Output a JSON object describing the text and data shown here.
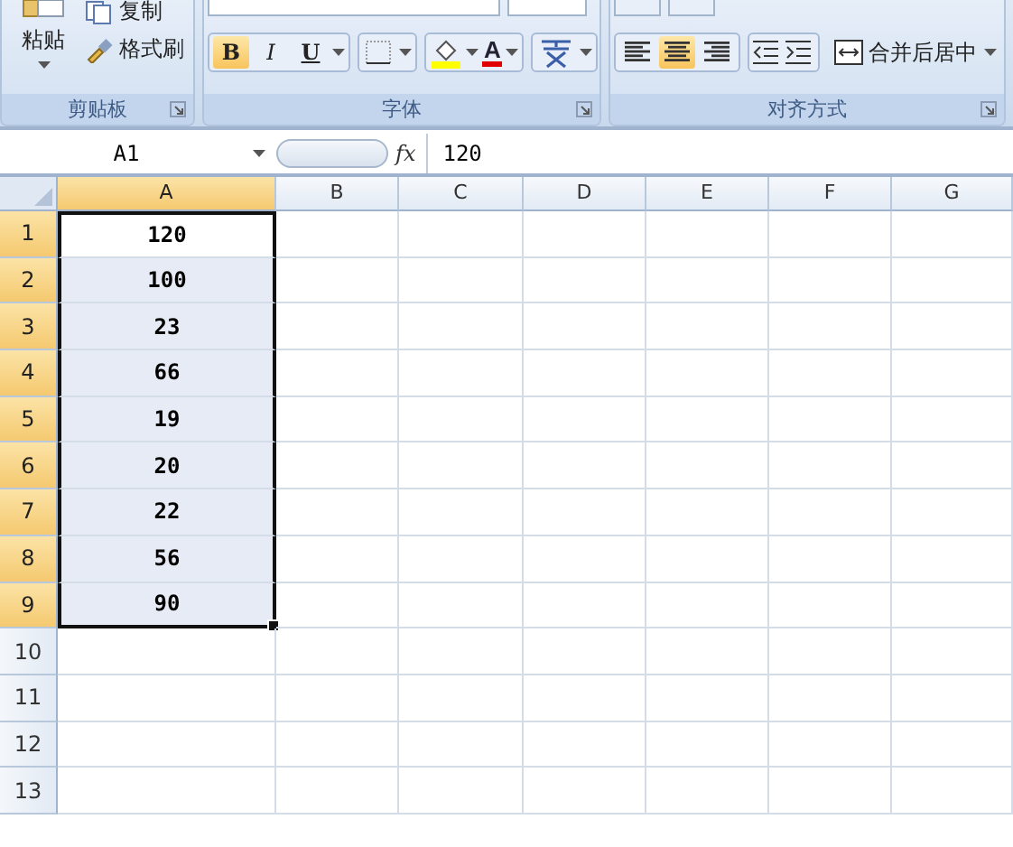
{
  "ribbon": {
    "groups": [
      {
        "kind": "clipboard",
        "label": "剪贴板",
        "paste_label": "粘贴",
        "items": [
          {
            "kind": "copy",
            "label": "复制"
          },
          {
            "kind": "painter",
            "label": "格式刷"
          }
        ]
      },
      {
        "kind": "font",
        "label": "字体",
        "style_buttons": [
          {
            "label": "B",
            "selected": true
          },
          {
            "label": "I",
            "selected": false
          },
          {
            "label": "U",
            "selected": false
          }
        ],
        "font_color_label": "A"
      },
      {
        "kind": "alignment",
        "label": "对齐方式",
        "align_buttons": [
          {
            "selected": false
          },
          {
            "selected": true
          },
          {
            "selected": false
          }
        ],
        "merge_label": "合并后居中"
      }
    ]
  },
  "formula_bar": {
    "name_box": "A1",
    "function_label": "fx",
    "formula": "120"
  },
  "sheet": {
    "columns": [
      {
        "label": "A",
        "selected": true
      },
      {
        "label": "B",
        "selected": false
      },
      {
        "label": "C",
        "selected": false
      },
      {
        "label": "D",
        "selected": false
      },
      {
        "label": "E",
        "selected": false
      },
      {
        "label": "F",
        "selected": false
      },
      {
        "label": "G",
        "selected": false
      }
    ],
    "rows": [
      {
        "label": "1",
        "selected": true,
        "value": "120"
      },
      {
        "label": "2",
        "selected": true,
        "value": "100"
      },
      {
        "label": "3",
        "selected": true,
        "value": "23"
      },
      {
        "label": "4",
        "selected": true,
        "value": "66"
      },
      {
        "label": "5",
        "selected": true,
        "value": "19"
      },
      {
        "label": "6",
        "selected": true,
        "value": "20"
      },
      {
        "label": "7",
        "selected": true,
        "value": "22"
      },
      {
        "label": "8",
        "selected": true,
        "value": "56"
      },
      {
        "label": "9",
        "selected": true,
        "value": "90"
      },
      {
        "label": "10",
        "selected": false,
        "value": ""
      },
      {
        "label": "11",
        "selected": false,
        "value": ""
      },
      {
        "label": "12",
        "selected": false,
        "value": ""
      },
      {
        "label": "13",
        "selected": false,
        "value": ""
      }
    ]
  }
}
